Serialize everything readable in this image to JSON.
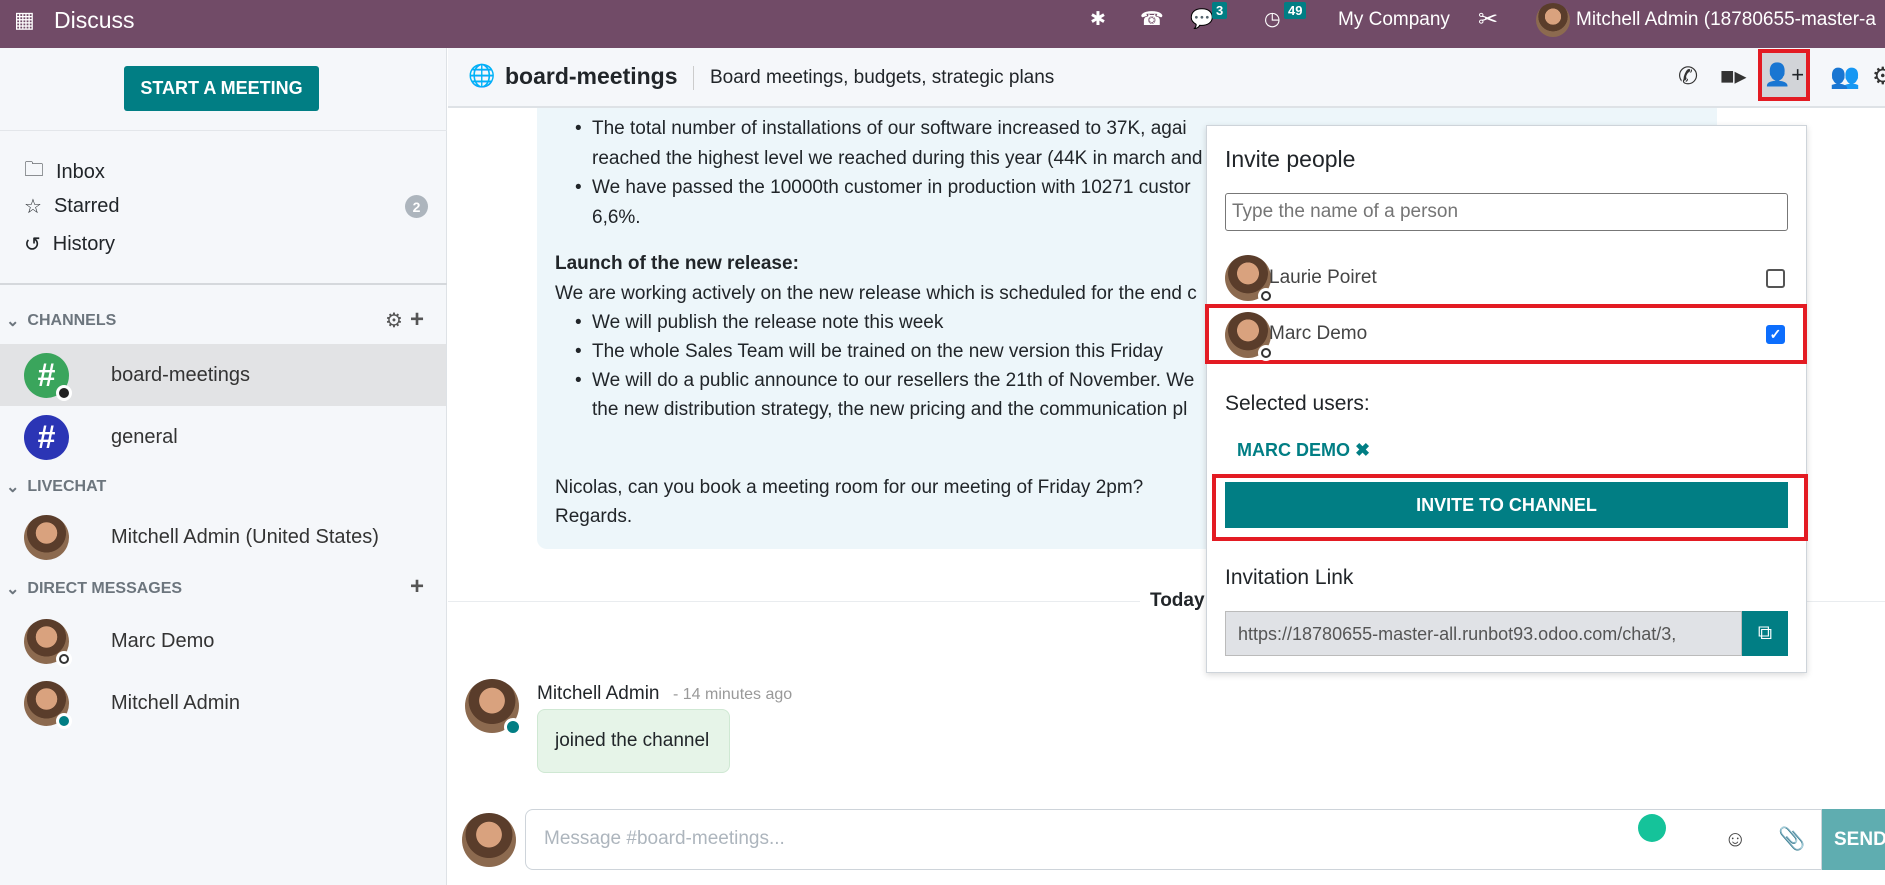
{
  "navbar": {
    "app_title": "Discuss",
    "messages_count": "3",
    "activities_count": "49",
    "company": "My Company",
    "user": "Mitchell Admin (18780655-master-a"
  },
  "sidebar": {
    "start_meeting": "START A MEETING",
    "mailboxes": [
      {
        "label": "Inbox"
      },
      {
        "label": "Starred",
        "count": "2"
      },
      {
        "label": "History"
      }
    ],
    "channels_header": "CHANNELS",
    "channels": [
      {
        "label": "board-meetings",
        "color": "#3aa55c"
      },
      {
        "label": "general",
        "color": "#2b35b5"
      }
    ],
    "livechat_header": "LIVECHAT",
    "livechat": [
      {
        "label": "Mitchell Admin (United States)"
      }
    ],
    "dm_header": "DIRECT MESSAGES",
    "dms": [
      {
        "label": "Marc Demo"
      },
      {
        "label": "Mitchell Admin"
      }
    ]
  },
  "thread": {
    "name": "board-meetings",
    "description": "Board meetings, budgets, strategic plans",
    "message_lines": [
      "The total number of installations of our software increased to 37K, agai",
      "reached the highest level we reached during this year (44K in march and",
      "We have passed the 10000th customer in production with 10271 custor",
      "6,6%.",
      "Launch of the new release:",
      "We are working actively on the new release which is scheduled for the end c",
      "We will publish the release note this week",
      "The whole Sales Team will be trained on the new version this Friday",
      "We will do a public announce to our resellers the 21th of November. We",
      "the new distribution strategy, the new pricing and the communication pl",
      "Nicolas, can you book a meeting room for our meeting of Friday 2pm?",
      "Regards."
    ],
    "separator": "Today",
    "last_author": "Mitchell Admin",
    "last_time": "- 14 minutes ago",
    "last_body": "joined the channel",
    "composer_placeholder": "Message #board-meetings...",
    "send": "SEND"
  },
  "invite": {
    "title": "Invite people",
    "search_placeholder": "Type the name of a person",
    "people": [
      {
        "name": "Laurie Poiret",
        "checked": false
      },
      {
        "name": "Marc Demo",
        "checked": true
      }
    ],
    "selected_title": "Selected users:",
    "selected": [
      "MARC DEMO"
    ],
    "invite_button": "INVITE TO CHANNEL",
    "link_title": "Invitation Link",
    "link": "https://18780655-master-all.runbot93.odoo.com/chat/3,"
  },
  "colors": {
    "brand": "#714b67",
    "accent": "#017e84",
    "highlight": "#e31b23"
  }
}
